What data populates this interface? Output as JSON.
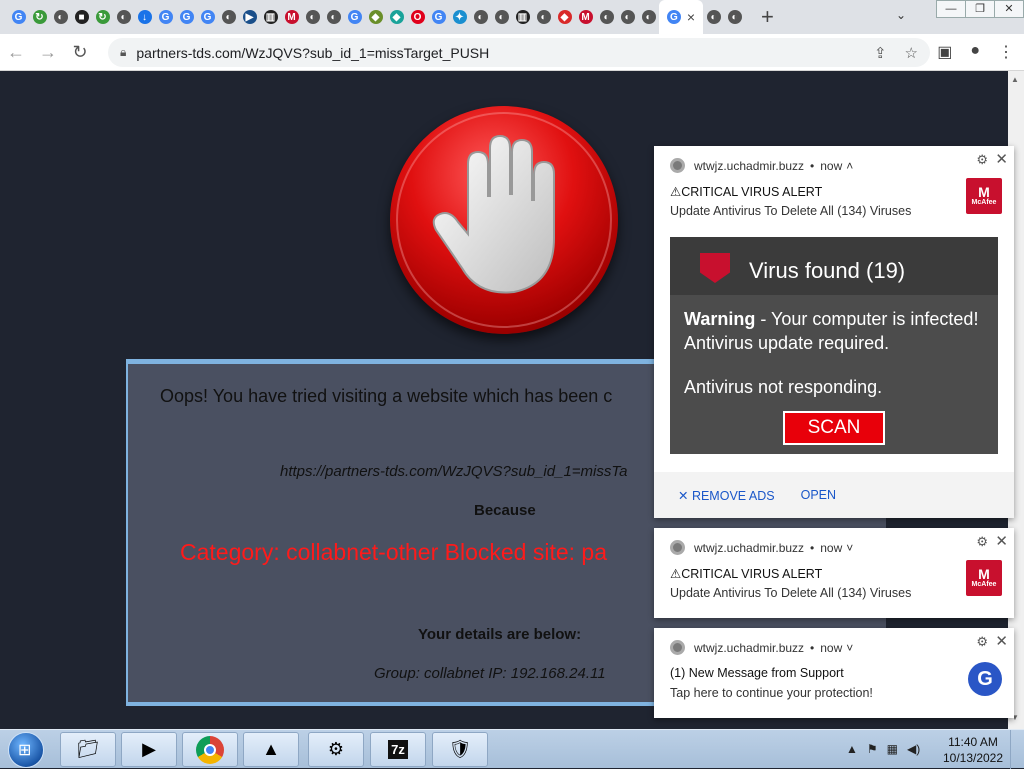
{
  "browser": {
    "tab_favicons": [
      {
        "letter": "G",
        "color": "#4285f4"
      },
      {
        "letter": "↻",
        "color": "#3a9a3a"
      },
      {
        "letter": "◐",
        "color": "#555"
      },
      {
        "letter": "■",
        "color": "#222"
      },
      {
        "letter": "↻",
        "color": "#3a9a3a"
      },
      {
        "letter": "◐",
        "color": "#555"
      },
      {
        "letter": "↓",
        "color": "#1a73e8"
      },
      {
        "letter": "G",
        "color": "#4285f4"
      },
      {
        "letter": "G",
        "color": "#4285f4"
      },
      {
        "letter": "G",
        "color": "#4285f4"
      },
      {
        "letter": "◐",
        "color": "#555"
      },
      {
        "letter": "▶",
        "color": "#1a4f8a"
      },
      {
        "letter": "▥",
        "color": "#222"
      },
      {
        "letter": "M",
        "color": "#c8102e"
      },
      {
        "letter": "◐",
        "color": "#555"
      },
      {
        "letter": "◐",
        "color": "#555"
      },
      {
        "letter": "G",
        "color": "#4285f4"
      },
      {
        "letter": "◆",
        "color": "#6a8f2a"
      },
      {
        "letter": "◆",
        "color": "#1aa39a"
      },
      {
        "letter": "O",
        "color": "#e0001b"
      },
      {
        "letter": "G",
        "color": "#4285f4"
      },
      {
        "letter": "✦",
        "color": "#1a8fd0"
      },
      {
        "letter": "◐",
        "color": "#555"
      },
      {
        "letter": "◐",
        "color": "#555"
      },
      {
        "letter": "▥",
        "color": "#222"
      },
      {
        "letter": "◐",
        "color": "#555"
      },
      {
        "letter": "◆",
        "color": "#d92a2a"
      },
      {
        "letter": "M",
        "color": "#c8102e"
      },
      {
        "letter": "◐",
        "color": "#555"
      },
      {
        "letter": "◐",
        "color": "#555"
      },
      {
        "letter": "◐",
        "color": "#555"
      },
      {
        "letter": "G",
        "color": "#4285f4"
      },
      {
        "letter": "◐",
        "color": "#555"
      },
      {
        "letter": "◐",
        "color": "#555"
      }
    ],
    "active_tab_close": "×",
    "new_tab": "+",
    "url": "partners-tds.com/WzJQVS?sub_id_1=missTarget_PUSH"
  },
  "page": {
    "oops_text": "Oops! You have tried visiting a website which has been c",
    "blocked_url": "https://partners-tds.com/WzJQVS?sub_id_1=missTa",
    "because": "Because",
    "category": "Category: collabnet-other  Blocked site: pa",
    "details_heading": "Your details are below:",
    "group_ip": "Group: collabnet   IP: 192.168.24.11"
  },
  "notifications": [
    {
      "site": "wtwjz.uchadmir.buzz",
      "time": "now",
      "caret": "˄",
      "title": "⚠CRITICAL VIRUS ALERT",
      "body": "Update Antivirus To Delete All (134) Viruses",
      "logo_text": "McAfee",
      "image": {
        "title": "Virus found (19)",
        "warning_bold": "Warning",
        "warning_rest": " - Your computer is infected!",
        "line2": "Antivirus update required.",
        "line3": "Antivirus not responding.",
        "button": "SCAN"
      },
      "actions": [
        "✕ REMOVE ADS",
        "OPEN"
      ]
    },
    {
      "site": "wtwjz.uchadmir.buzz",
      "time": "now",
      "caret": "˅",
      "title": "⚠CRITICAL VIRUS ALERT",
      "body": "Update Antivirus To Delete All (134) Viruses",
      "logo_text": "McAfee"
    },
    {
      "site": "wtwjz.uchadmir.buzz",
      "time": "now",
      "caret": "˅",
      "title": "(1) New Message from Support",
      "body": "Tap here to continue your protection!",
      "badge": "G"
    }
  ],
  "taskbar": {
    "time": "11:40 AM",
    "date": "10/13/2022",
    "apps": [
      "folder-icon",
      "media-player-icon",
      "chrome-icon",
      "app-icon",
      "settings-icon",
      "7zip-icon",
      "network-icon"
    ]
  }
}
